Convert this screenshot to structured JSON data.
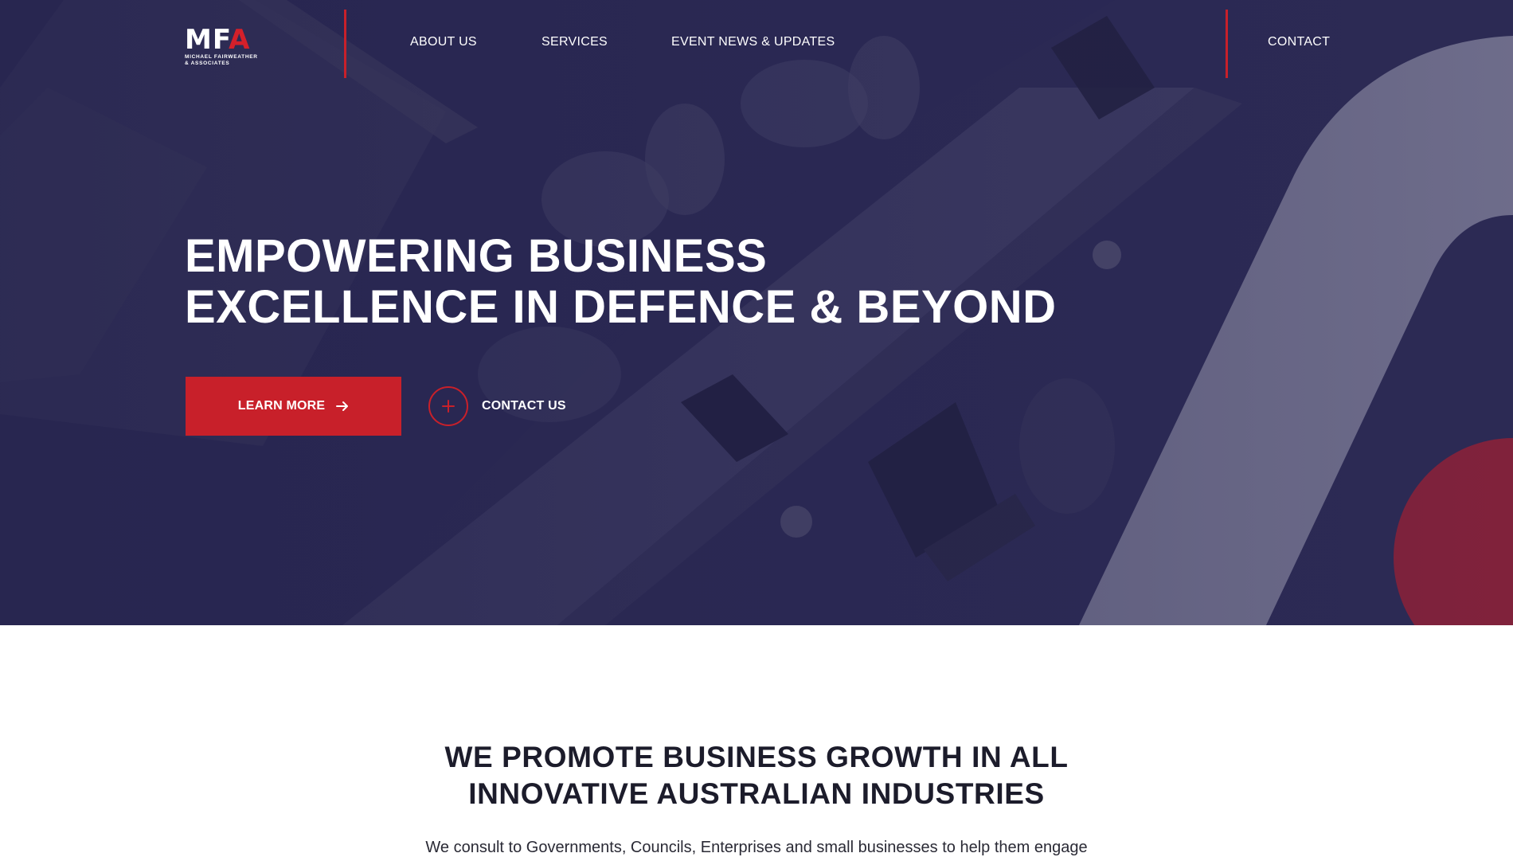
{
  "header": {
    "logo": {
      "mark_main": "MF",
      "mark_accent": "A",
      "line1": "MICHAEL FAIRWEATHER",
      "line2": "& ASSOCIATES"
    },
    "nav": {
      "about": "ABOUT US",
      "services": "SERVICES",
      "events": "EVENT NEWS & UPDATES",
      "contact": "CONTACT"
    }
  },
  "hero": {
    "headline": {
      "line1_bold": "EMPOWERING",
      "line1_regular": " BUSINESS",
      "line2_regular": "EXCELLENCE IN ",
      "line2_bold": "DEFENCE & BEYOND"
    },
    "learn_more_label": "LEARN MORE",
    "learn_more_icon": "arrow-right-icon",
    "contact_us_label": "CONTACT US",
    "contact_us_icon": "plus-icon"
  },
  "intro": {
    "title_regular_1": "WE ",
    "title_bold": "PROMOTE BUSINESS GROWTH",
    "title_regular_2": " IN ALL",
    "title_line2": "INNOVATIVE AUSTRALIAN INDUSTRIES",
    "text": "We consult to Governments, Councils, Enterprises and small businesses to help them engage"
  },
  "colors": {
    "brand_red": "#c8202a",
    "hero_navy": "#2b2950",
    "text_dark": "#1c1c2b",
    "white": "#ffffff"
  }
}
